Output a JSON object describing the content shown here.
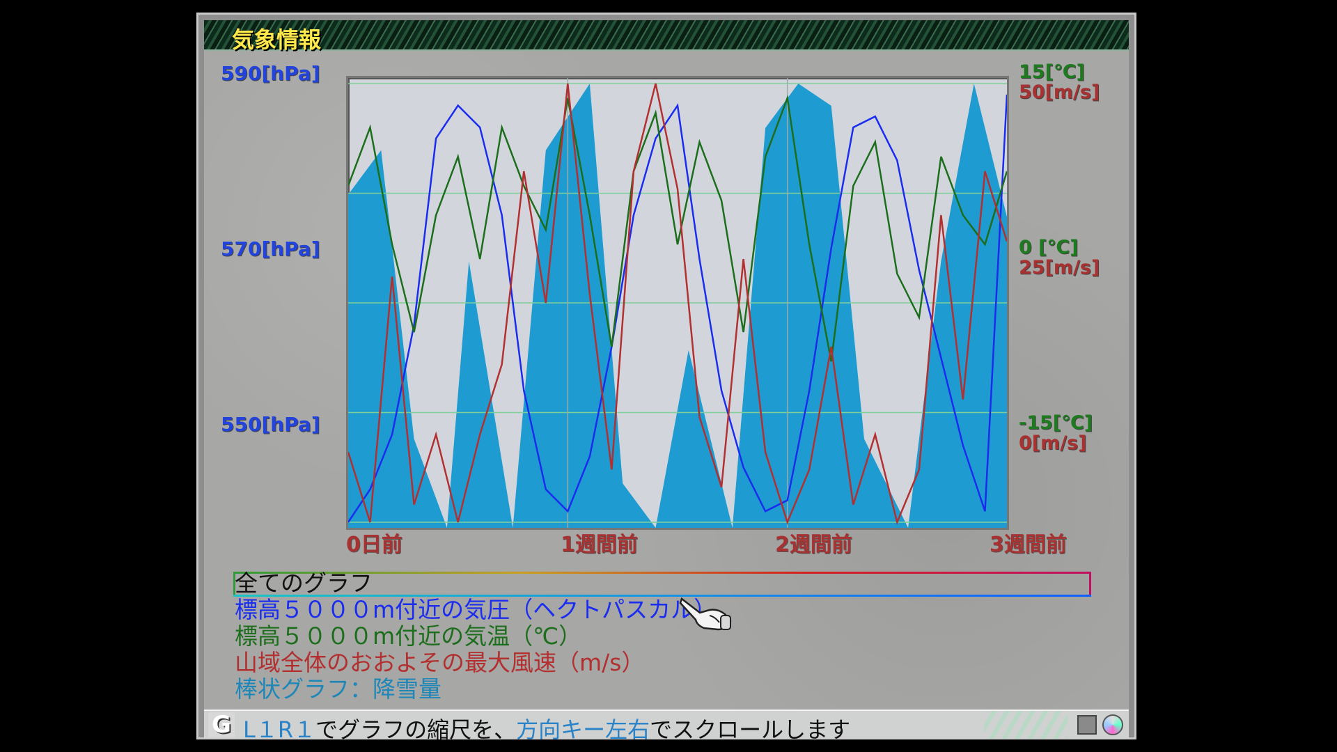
{
  "window": {
    "title": "気象情報"
  },
  "axes": {
    "left": [
      "590[hPa]",
      "570[hPa]",
      "550[hPa]"
    ],
    "right_temp": [
      "15[℃]",
      "0 [℃]",
      "-15[℃]"
    ],
    "right_wind": [
      "50[m/s]",
      "25[m/s]",
      "0[m/s]"
    ]
  },
  "x_labels": [
    "0日前",
    "1週間前",
    "2週間前",
    "3週間前"
  ],
  "legend": {
    "all": "全てのグラフ",
    "pressure": "標高５０００m付近の気圧（ヘクトパスカル）",
    "temp": "標高５０００m付近の気温（℃）",
    "wind": "山域全体のおおよその最大風速（m/s）",
    "snow": "棒状グラフ：降雪量"
  },
  "status": {
    "buttons": "L１R１",
    "text1": "でグラフの縮尺を、",
    "keys": "方向キー左右",
    "text2": "でスクロールします",
    "g_label": "G"
  },
  "colors": {
    "pressure": "#1a2cf0",
    "temp": "#1c6e1c",
    "wind": "#b23030",
    "snow": "#1e9bd0",
    "plot_bg": "#d2d6dc"
  },
  "chart_data": {
    "type": "line",
    "x_domain": [
      0,
      3
    ],
    "x_unit": "weeks ago",
    "series": [
      {
        "name": "標高５０００m付近の気圧（ヘクトパスカル）",
        "axis": "hPa",
        "ylim": [
          550,
          590
        ],
        "x": [
          0,
          0.1,
          0.2,
          0.3,
          0.4,
          0.5,
          0.6,
          0.7,
          0.8,
          0.9,
          1.0,
          1.1,
          1.2,
          1.3,
          1.4,
          1.5,
          1.6,
          1.7,
          1.8,
          1.9,
          2.0,
          2.1,
          2.2,
          2.3,
          2.4,
          2.5,
          2.6,
          2.7,
          2.8,
          2.9,
          3.0
        ],
        "y": [
          550,
          553,
          558,
          568,
          585,
          588,
          586,
          578,
          562,
          553,
          551,
          556,
          566,
          578,
          585,
          588,
          574,
          562,
          555,
          551,
          552,
          562,
          575,
          586,
          587,
          583,
          573,
          565,
          557,
          551,
          589
        ]
      },
      {
        "name": "標高５０００m付近の気温（℃）",
        "axis": "℃",
        "ylim": [
          -15,
          15
        ],
        "x": [
          0,
          0.1,
          0.2,
          0.3,
          0.4,
          0.5,
          0.6,
          0.7,
          0.8,
          0.9,
          1.0,
          1.1,
          1.2,
          1.3,
          1.4,
          1.5,
          1.6,
          1.7,
          1.8,
          1.9,
          2.0,
          2.1,
          2.2,
          2.3,
          2.4,
          2.5,
          2.6,
          2.7,
          2.8,
          2.9,
          3.0
        ],
        "y": [
          8,
          12,
          4,
          -2,
          6,
          10,
          3,
          12,
          8,
          5,
          14,
          6,
          -3,
          9,
          13,
          4,
          11,
          7,
          -2,
          10,
          14,
          4,
          -4,
          8,
          11,
          2,
          -1,
          10,
          6,
          4,
          9
        ]
      },
      {
        "name": "山域全体のおおよその最大風速（m/s）",
        "axis": "m/s",
        "ylim": [
          0,
          50
        ],
        "x": [
          0,
          0.1,
          0.2,
          0.3,
          0.4,
          0.5,
          0.6,
          0.7,
          0.8,
          0.9,
          1.0,
          1.1,
          1.2,
          1.3,
          1.4,
          1.5,
          1.6,
          1.7,
          1.8,
          1.9,
          2.0,
          2.1,
          2.2,
          2.3,
          2.4,
          2.5,
          2.6,
          2.7,
          2.8,
          2.9,
          3.0
        ],
        "y": [
          8,
          0,
          28,
          2,
          10,
          0,
          10,
          18,
          40,
          25,
          50,
          26,
          6,
          40,
          50,
          38,
          12,
          4,
          30,
          8,
          0,
          6,
          20,
          2,
          10,
          0,
          6,
          35,
          14,
          40,
          32
        ]
      },
      {
        "name": "棒状グラフ：降雪量",
        "axis": "relative",
        "x": [
          0,
          0.15,
          0.3,
          0.45,
          0.55,
          0.75,
          0.9,
          1.1,
          1.25,
          1.4,
          1.55,
          1.75,
          1.9,
          2.05,
          2.2,
          2.35,
          2.55,
          2.7,
          2.85,
          3.0
        ],
        "y": [
          0.75,
          0.85,
          0.2,
          0.0,
          0.6,
          0.0,
          0.85,
          1.0,
          0.1,
          0.0,
          0.4,
          0.0,
          0.9,
          1.0,
          0.95,
          0.2,
          0.0,
          0.6,
          1.0,
          0.7
        ]
      }
    ]
  }
}
